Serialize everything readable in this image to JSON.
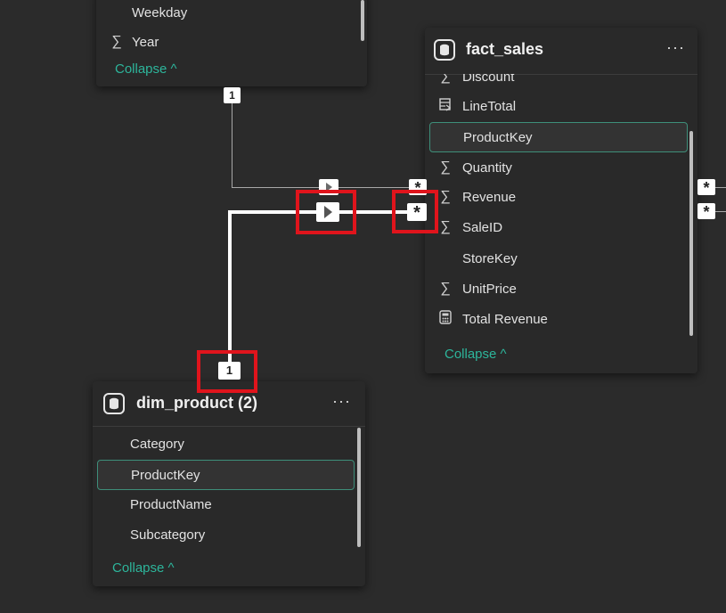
{
  "top_table": {
    "fields": [
      {
        "icon": "",
        "label": "Weekday"
      },
      {
        "icon": "∑",
        "label": "Year"
      }
    ],
    "collapse_label": "Collapse"
  },
  "fact_sales": {
    "title": "fact_sales",
    "more_label": "···",
    "fields": [
      {
        "icon": "∑",
        "label": "Discount"
      },
      {
        "icon": "column-function-icon",
        "label": "LineTotal"
      },
      {
        "icon": "",
        "label": "ProductKey"
      },
      {
        "icon": "∑",
        "label": "Quantity"
      },
      {
        "icon": "∑",
        "label": "Revenue"
      },
      {
        "icon": "∑",
        "label": "SaleID"
      },
      {
        "icon": "",
        "label": "StoreKey"
      },
      {
        "icon": "∑",
        "label": "UnitPrice"
      },
      {
        "icon": "calculator-icon",
        "label": "Total Revenue"
      }
    ],
    "collapse_label": "Collapse"
  },
  "dim_product": {
    "title": "dim_product (2)",
    "more_label": "···",
    "fields": [
      {
        "icon": "",
        "label": "Category"
      },
      {
        "icon": "",
        "label": "ProductKey"
      },
      {
        "icon": "",
        "label": "ProductName"
      },
      {
        "icon": "",
        "label": "Subcategory"
      }
    ],
    "collapse_label": "Collapse"
  },
  "relationships": {
    "one_label": "1",
    "many_label": "*"
  },
  "colors": {
    "accent": "#2db59b",
    "highlight_box": "#e0141c",
    "canvas": "#2b2b2b"
  }
}
